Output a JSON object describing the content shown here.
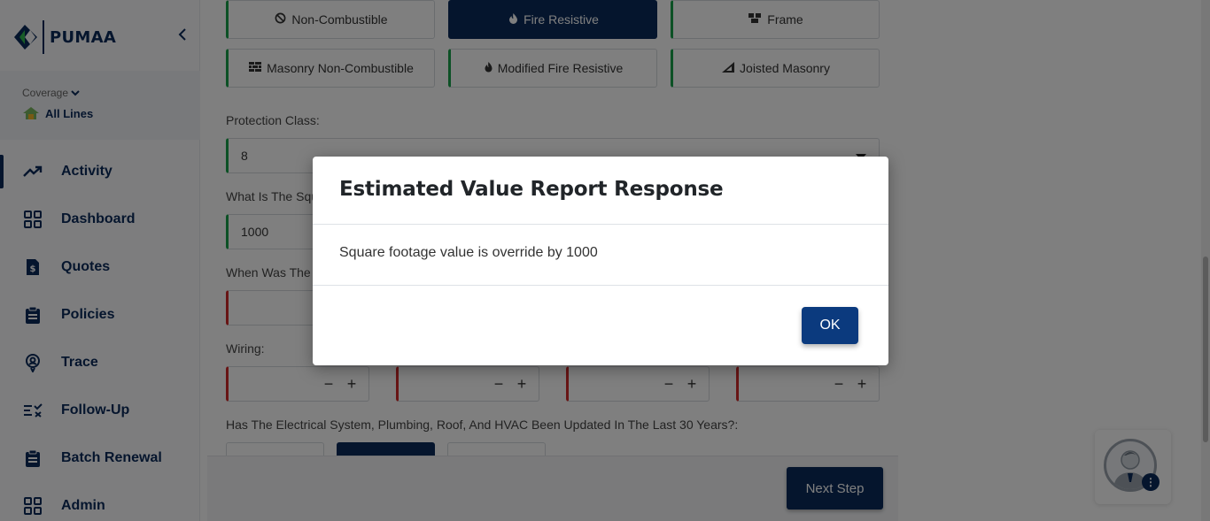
{
  "app": {
    "name": "PUMAA"
  },
  "coverage": {
    "label": "Coverage",
    "value": "All Lines"
  },
  "nav": [
    {
      "label": "Activity",
      "icon": "trending-up-icon",
      "active": true
    },
    {
      "label": "Dashboard",
      "icon": "grid-icon"
    },
    {
      "label": "Quotes",
      "icon": "dollar-file-icon"
    },
    {
      "label": "Policies",
      "icon": "clipboard-icon"
    },
    {
      "label": "Trace",
      "icon": "location-pin-icon"
    },
    {
      "label": "Follow-Up",
      "icon": "list-check-icon"
    },
    {
      "label": "Batch Renewal",
      "icon": "clipboard-icon"
    },
    {
      "label": "Admin",
      "icon": "grid-icon"
    }
  ],
  "construction_types": [
    {
      "label": "Non-Combustible",
      "icon": "ban-icon",
      "selected": false
    },
    {
      "label": "Fire Resistive",
      "icon": "flame-icon",
      "selected": true
    },
    {
      "label": "Frame",
      "icon": "boxes-icon",
      "selected": false
    },
    {
      "label": "Masonry Non-Combustible",
      "icon": "brick-icon",
      "selected": false
    },
    {
      "label": "Modified Fire Resistive",
      "icon": "fire-icon",
      "selected": false
    },
    {
      "label": "Joisted Masonry",
      "icon": "ruler-icon",
      "selected": false
    }
  ],
  "form": {
    "protection_class_label": "Protection Class:",
    "protection_class_value": "8",
    "square_footage_label": "What Is The Squ",
    "square_footage_value": "1000",
    "year_built_label": "When Was The",
    "wiring_label": "Wiring:",
    "stepper_minus": "−",
    "stepper_plus": "+",
    "updated_question": "Has The Electrical System, Plumbing, Roof, And HVAC Been Updated In The Last 30 Years?:"
  },
  "footer": {
    "next_label": "Next Step"
  },
  "modal": {
    "title": "Estimated Value Report Response",
    "message": "Square footage value is override by 1000",
    "ok_label": "OK"
  },
  "colors": {
    "brand": "#0b2a5b",
    "valid": "#19a34a",
    "invalid": "#d12a2a"
  }
}
